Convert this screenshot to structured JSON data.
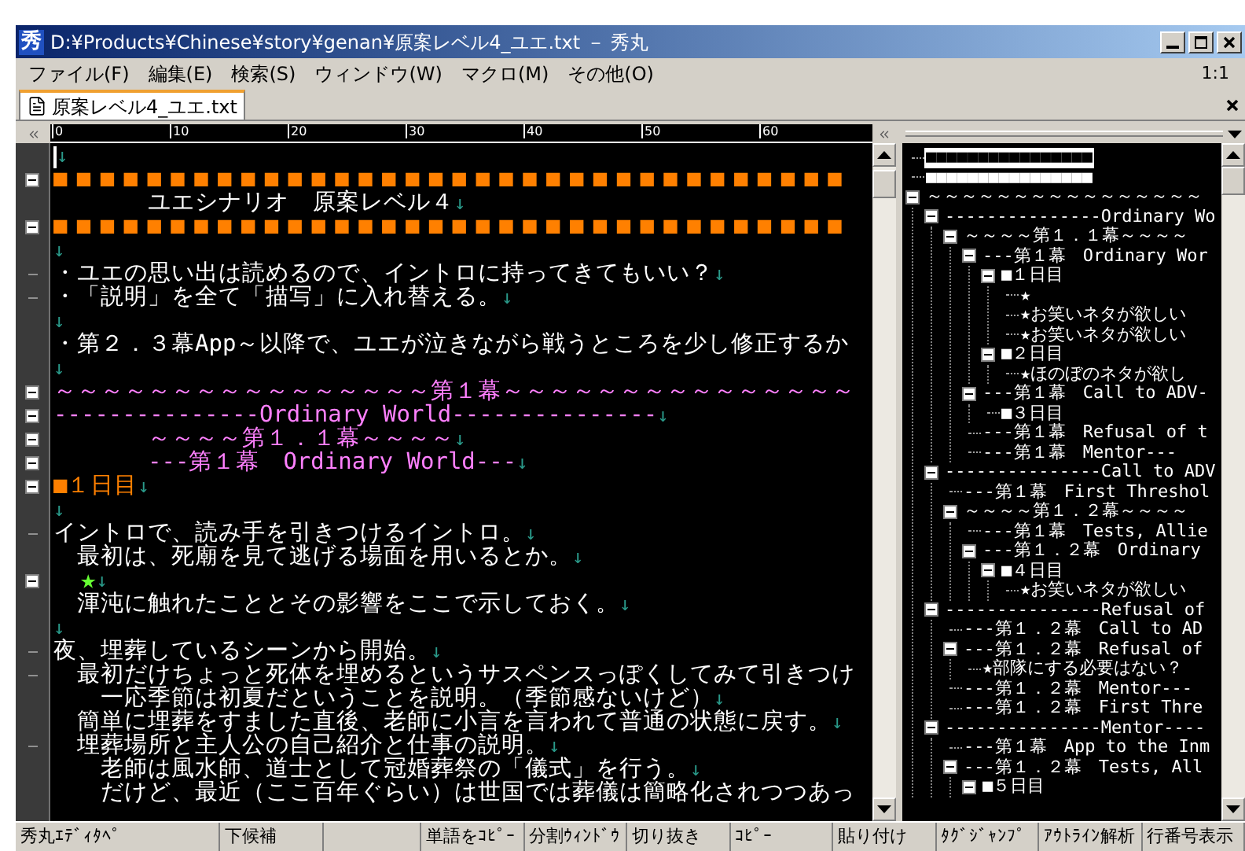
{
  "window": {
    "icon": "秀",
    "title": "D:¥Products¥Chinese¥story¥genan¥原案レベル4_ユエ.txt － 秀丸"
  },
  "menu": [
    {
      "label": "ファイル(F)"
    },
    {
      "label": "編集(E)"
    },
    {
      "label": "検索(S)"
    },
    {
      "label": "ウィンドウ(W)"
    },
    {
      "label": "マクロ(M)"
    },
    {
      "label": "その他(O)"
    }
  ],
  "position": "1:1",
  "tabs": [
    {
      "label": "原案レベル4_ユエ.txt",
      "selected": true
    }
  ],
  "ruler": [
    "0",
    "10",
    "20",
    "30",
    "40",
    "50",
    "60"
  ],
  "editor": {
    "lines": [
      {
        "caret": true,
        "eol": "↓"
      },
      {
        "kind": "bar",
        "gutter": {
          "kind": "fold"
        },
        "caret": false,
        "text": "■■■■■■■■■■■■■■■■■■■■■■■■■■■■■■■■■■"
      },
      {
        "kind": "plain",
        "caret": false,
        "text": "　　　　ユエシナリオ　原案レベル４",
        "eol": "↓"
      },
      {
        "kind": "bar",
        "gutter": {
          "kind": "fold"
        },
        "caret": false,
        "text": "■■■■■■■■■■■■■■■■■■■■■■■■■■■■■■■■■■"
      },
      {
        "caret": false,
        "eol": "↓"
      },
      {
        "kind": "plain",
        "gutter": {
          "kind": "dash"
        },
        "caret": false,
        "text": "・ユエの思い出は読めるので、イントロに持ってきてもいい？",
        "eol": "↓"
      },
      {
        "kind": "plain",
        "gutter": {
          "kind": "dash"
        },
        "caret": false,
        "text": "・「説明」を全て「描写」に入れ替える。",
        "eol": "↓"
      },
      {
        "caret": false,
        "eol": "↓"
      },
      {
        "kind": "plain",
        "caret": false,
        "text": "・第２．３幕App～以降で、ユエが泣きながら戦うところを少し修正するか"
      },
      {
        "caret": false,
        "eol": "↓"
      },
      {
        "kind": "section",
        "gutter": {
          "kind": "fold"
        },
        "caret": false,
        "text": "～～～～～～～～～～～～～～～～第１幕～～～～～～～～～～～～～～～"
      },
      {
        "kind": "section",
        "gutter": {
          "kind": "fold"
        },
        "caret": false,
        "text": "---------------Ordinary World---------------",
        "eol": "↓"
      },
      {
        "kind": "section",
        "gutter": {
          "kind": "fold"
        },
        "caret": false,
        "text": "　　　　～～～～第１．１幕～～～～",
        "eol": "↓"
      },
      {
        "kind": "section",
        "gutter": {
          "kind": "fold"
        },
        "caret": false,
        "text": "　　　　---第１幕　Ordinary World---",
        "eol": "↓"
      },
      {
        "kind": "day",
        "gutter": {
          "kind": "fold"
        },
        "caret": false,
        "text": "■１日目",
        "eol": "↓"
      },
      {
        "caret": false,
        "eol": "↓"
      },
      {
        "kind": "plain",
        "gutter": {
          "kind": "dash"
        },
        "caret": false,
        "text": "イントロで、読み手を引きつけるイントロ。",
        "eol": "↓"
      },
      {
        "kind": "plain",
        "caret": false,
        "text": "　最初は、死廟を見て逃げる場面を用いるとか。",
        "eol": "↓"
      },
      {
        "kind": "star",
        "gutter": {
          "kind": "fold"
        },
        "caret": false,
        "text": "　★",
        "eol": "↓"
      },
      {
        "kind": "plain",
        "caret": false,
        "text": "　渾沌に触れたこととその影響をここで示しておく。",
        "eol": "↓"
      },
      {
        "caret": false,
        "eol": "↓"
      },
      {
        "kind": "plain",
        "gutter": {
          "kind": "dash"
        },
        "caret": false,
        "text": "夜、埋葬しているシーンから開始。",
        "eol": "↓"
      },
      {
        "kind": "plain",
        "gutter": {
          "kind": "dash"
        },
        "caret": false,
        "text": "　最初だけちょっと死体を埋めるというサスペンスっぽくしてみて引きつけ"
      },
      {
        "kind": "plain",
        "caret": false,
        "text": "　　一応季節は初夏だということを説明。（季節感ないけど）",
        "eol": "↓"
      },
      {
        "kind": "plain",
        "caret": false,
        "text": "　簡単に埋葬をすました直後、老師に小言を言われて普通の状態に戻す。",
        "eol": "↓"
      },
      {
        "kind": "plain",
        "gutter": {
          "kind": "dash"
        },
        "caret": false,
        "text": "　埋葬場所と主人公の自己紹介と仕事の説明。",
        "eol": "↓"
      },
      {
        "kind": "plain",
        "caret": false,
        "text": "　　老師は風水師、道士として冠婚葬祭の「儀式」を行う。",
        "eol": "↓"
      },
      {
        "kind": "plain",
        "caret": false,
        "text": "　　だけど、最近（ここ百年ぐらい）は世国では葬儀は簡略化されつつあっ"
      }
    ]
  },
  "outline": {
    "items": [
      {
        "label": "■■■■■■■■■■■■■■■■",
        "selected": true
      },
      {
        "label": "■■■■■■■■■■■■■■■■",
        "selected": false
      },
      {
        "label": "～～～～～～～～～～～～～～～～",
        "selected": false,
        "expanded": true,
        "children": [
          {
            "label": "---------------Ordinary Wo",
            "selected": false,
            "expanded": true,
            "children": [
              {
                "label": "～～～～第１．１幕～～～～",
                "selected": false,
                "expanded": true,
                "children": [
                  {
                    "label": "---第１幕　Ordinary Wor",
                    "selected": false,
                    "expanded": true,
                    "children": [
                      {
                        "label": "■１日目",
                        "selected": false,
                        "expanded": true,
                        "children": [
                          {
                            "label": "★",
                            "selected": false
                          },
                          {
                            "label": "★お笑いネタが欲しい",
                            "selected": false
                          },
                          {
                            "label": "★お笑いネタが欲しい",
                            "selected": false
                          }
                        ]
                      },
                      {
                        "label": "■２日目",
                        "selected": false,
                        "expanded": true,
                        "children": [
                          {
                            "label": "★ほのぼのネタが欲し",
                            "selected": false
                          }
                        ]
                      }
                    ]
                  },
                  {
                    "label": "---第１幕　Call to ADV-",
                    "selected": false,
                    "expanded": true,
                    "children": [
                      {
                        "label": "■３日目",
                        "selected": false
                      }
                    ]
                  },
                  {
                    "label": "---第１幕　Refusal of t",
                    "selected": false
                  },
                  {
                    "label": "---第１幕　Mentor---",
                    "selected": false
                  }
                ]
              }
            ]
          },
          {
            "label": "---------------Call to ADV",
            "selected": false,
            "expanded": true,
            "children": [
              {
                "label": "---第１幕　First Threshol",
                "selected": false
              },
              {
                "label": "～～～～第１．２幕～～～～",
                "selected": false,
                "expanded": true,
                "children": [
                  {
                    "label": "---第１幕　Tests, Allie",
                    "selected": false
                  },
                  {
                    "label": "---第１．２幕　Ordinary",
                    "selected": false,
                    "expanded": true,
                    "children": [
                      {
                        "label": "■４日目",
                        "selected": false,
                        "expanded": true,
                        "children": [
                          {
                            "label": "★お笑いネタが欲しい",
                            "selected": false
                          }
                        ]
                      }
                    ]
                  }
                ]
              }
            ]
          },
          {
            "label": "---------------Refusal of",
            "selected": false,
            "expanded": true,
            "children": [
              {
                "label": "---第１．２幕　Call to AD",
                "selected": false
              },
              {
                "label": "---第１．２幕　Refusal of",
                "selected": false,
                "expanded": true,
                "children": [
                  {
                    "label": "★部隊にする必要はない？",
                    "selected": false
                  }
                ]
              },
              {
                "label": "---第１．２幕　Mentor---",
                "selected": false
              },
              {
                "label": "---第１．２幕　First Thre",
                "selected": false
              }
            ]
          },
          {
            "label": "---------------Mentor----",
            "selected": false,
            "expanded": true,
            "children": [
              {
                "label": "---第１幕　App to the Inm",
                "selected": false
              },
              {
                "label": "---第１．２幕　Tests, All",
                "selected": false,
                "expanded": true,
                "children": [
                  {
                    "label": "■５日目",
                    "selected": false,
                    "expanded": true
                  }
                ]
              }
            ]
          }
        ]
      }
    ]
  },
  "function_keys": [
    {
      "label": "秀丸ｴﾃﾞｨﾀﾍﾟ"
    },
    {
      "label": "下候補"
    },
    {
      "empty": true
    },
    {
      "label": "単語をｺﾋﾟｰ"
    },
    {
      "label": "分割ｳｨﾝﾄﾞｳ"
    },
    {
      "label": "切り抜き"
    },
    {
      "label": "ｺﾋﾟｰ"
    },
    {
      "label": "貼り付け"
    },
    {
      "label": "ﾀｸﾞｼﾞｬﾝﾌﾟ"
    },
    {
      "label": "ｱｳﾄﾗｲﾝ解析"
    },
    {
      "label": "行番号表示"
    }
  ]
}
